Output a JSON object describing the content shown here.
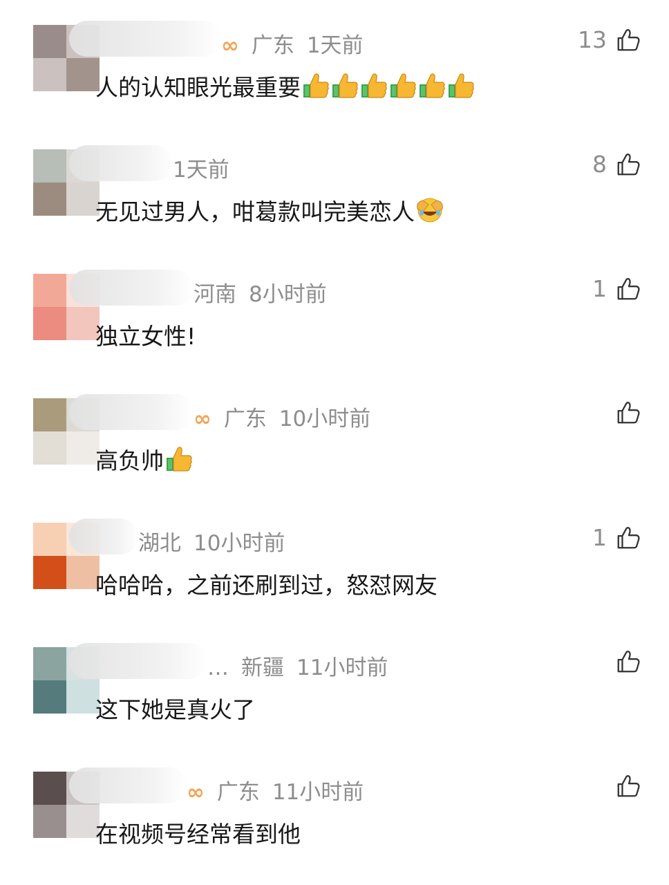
{
  "comments": [
    {
      "region": "广东",
      "time": "1天前",
      "text": "人的认知眼光最重要",
      "likes": "13",
      "emojis": [
        "thumbs-up-icon",
        "thumbs-up-icon",
        "thumbs-up-icon",
        "thumbs-up-icon",
        "thumbs-up-icon",
        "thumbs-up-icon"
      ],
      "has_badge": true,
      "avatar_colors": [
        "#9a8c8a",
        "#cbc1bf",
        "#cbc1bf",
        "#a3938d"
      ]
    },
    {
      "region": "",
      "time": "1天前",
      "text": "无见过男人，咁葛款叫完美恋人",
      "likes": "8",
      "emojis": [
        "facepalm-laugh-icon"
      ],
      "has_badge": false,
      "avatar_colors": [
        "#b7bdb7",
        "#dad9d5",
        "#9c8c80",
        "#d9d4cf"
      ]
    },
    {
      "region": "河南",
      "time": "8小时前",
      "text": "独立女性!",
      "likes": "1",
      "emojis": [],
      "has_badge": false,
      "avatar_colors": [
        "#f2a896",
        "#fbe0da",
        "#ec8c80",
        "#f3c6bd"
      ]
    },
    {
      "region": "广东",
      "time": "10小时前",
      "text": "高负帅",
      "likes": "",
      "emojis": [
        "thumbs-up-icon"
      ],
      "has_badge": true,
      "avatar_colors": [
        "#ab9b7d",
        "#dcdad2",
        "#e2ddd5",
        "#efebe6"
      ]
    },
    {
      "region": "湖北",
      "time": "10小时前",
      "text": "哈哈哈，之前还刷到过，怒怼网友",
      "likes": "1",
      "emojis": [],
      "has_badge": false,
      "avatar_colors": [
        "#f7cfb3",
        "#fbe6d8",
        "#d34f1a",
        "#efbfa3"
      ]
    },
    {
      "region": "新疆",
      "time": "11小时前",
      "text": "这下她是真火了",
      "likes": "",
      "emojis": [],
      "has_badge": false,
      "ellipsis": "…",
      "avatar_colors": [
        "#8ba49f",
        "#d7e1e1",
        "#557b7d",
        "#cfe0e1"
      ]
    },
    {
      "region": "广东",
      "time": "11小时前",
      "text": "在视频号经常看到他",
      "likes": "",
      "emojis": [],
      "has_badge": true,
      "avatar_colors": [
        "#5a4f4e",
        "#c9c2c3",
        "#9a8f8f",
        "#e0dcdc"
      ]
    }
  ]
}
